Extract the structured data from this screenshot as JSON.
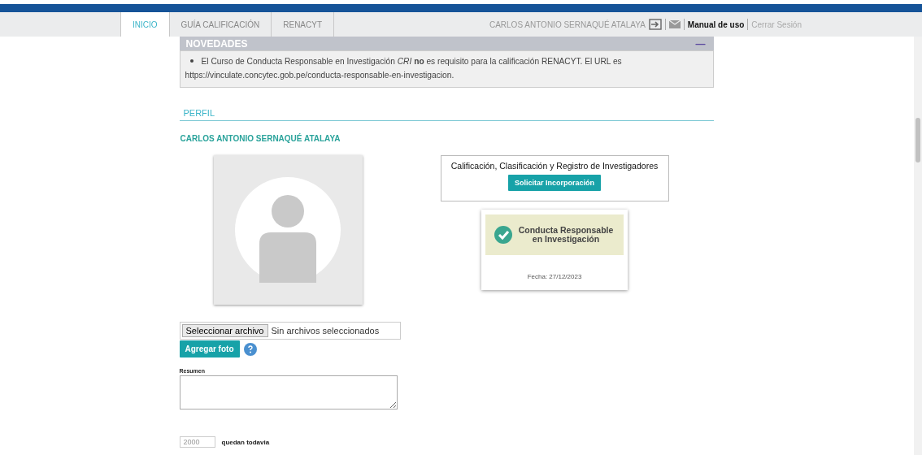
{
  "tabs": [
    {
      "label": "INICIO",
      "selected": true
    },
    {
      "label": "GUÍA CALIFICACIÓN",
      "selected": false
    },
    {
      "label": "RENACYT",
      "selected": false
    }
  ],
  "user_menu": {
    "user_name": "CARLOS ANTONIO SERNAQUÉ ATALAYA",
    "manual": "Manual de uso",
    "logout": "Cerrar Sesión"
  },
  "news": {
    "title": "NOVEDADES",
    "collapse_glyph": "—",
    "items": [
      "El Curso de Conducta Responsable en Investigación *CRI* **no** es requisito para la calificación RENACYT. El URL es https://vinculate.concytec.gob.pe/conducta-responsable-en-investigacion."
    ]
  },
  "profile": {
    "section_title": "PERFIL",
    "name": "CARLOS ANTONIO SERNAQUÉ ATALAYA",
    "registry_card": {
      "title": "Calificación, Clasificación y Registro de Investigadores",
      "button": "Solicitar Incorporación"
    },
    "certificate": {
      "title": "Conducta Responsable en Investigación",
      "date": "Fecha: 27/12/2023"
    },
    "file_input": {
      "button": "Seleccionar archivo",
      "status": "Sin archivos seleccionados"
    },
    "add_photo_button": "Agregar foto",
    "summary": {
      "label": "Resumen",
      "remaining": "2000",
      "remaining_label": "quedan todavia"
    }
  }
}
